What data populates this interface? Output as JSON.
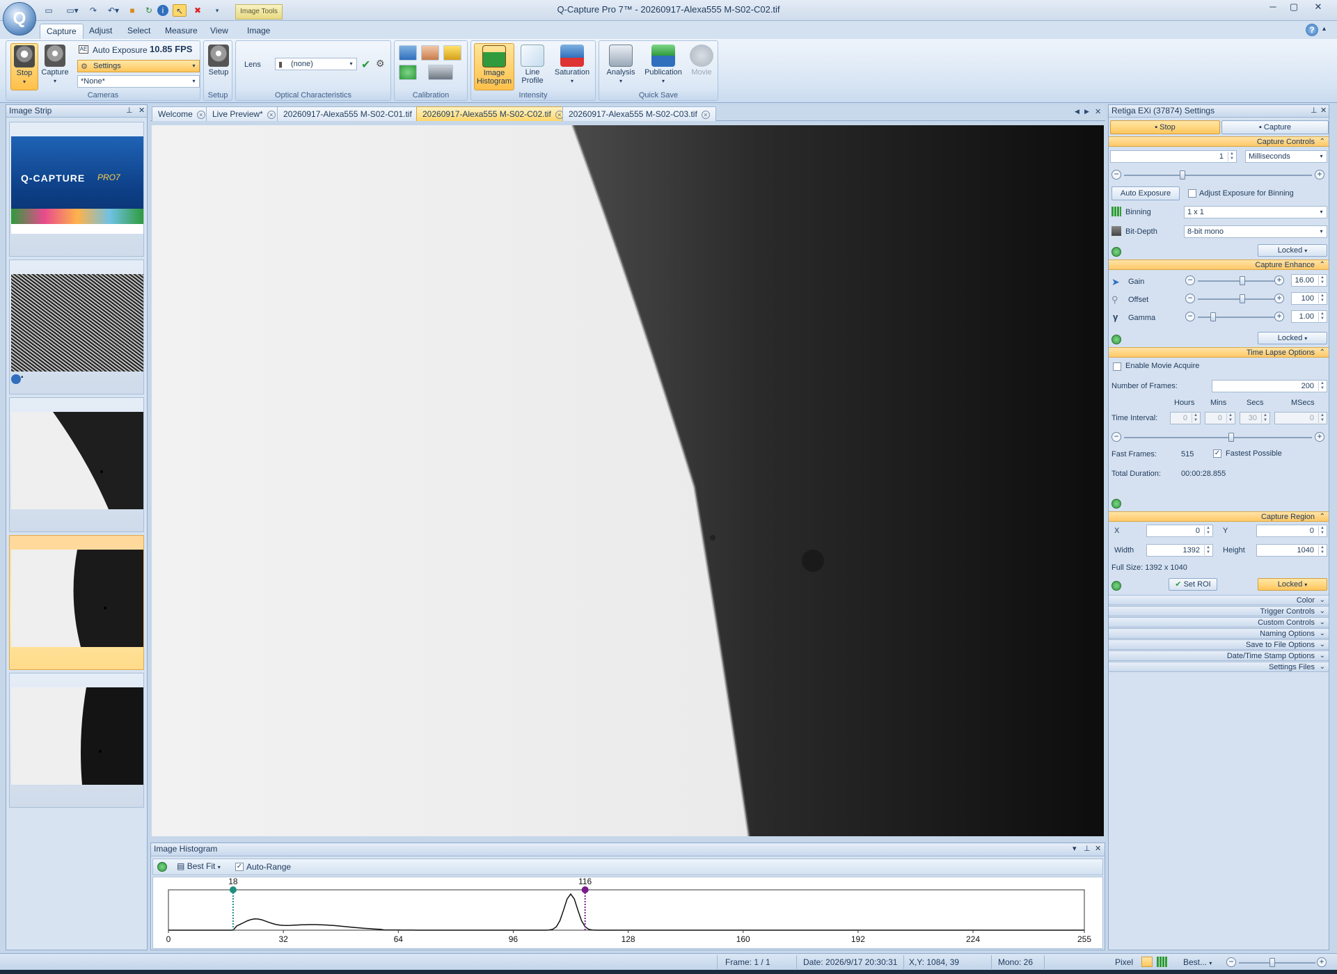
{
  "window": {
    "title": "Q-Capture Pro 7™ - 20260917-Alexa555 M-S02-C02.tif",
    "context_tab": "Image Tools",
    "orb_letter": "Q"
  },
  "ribbon_tabs": [
    "Capture",
    "Adjust",
    "Select",
    "Measure",
    "View",
    "Image"
  ],
  "ribbon": {
    "cameras": {
      "stop": "Stop",
      "capture": "Capture",
      "auto_exposure": "Auto Exposure",
      "fps": "10.85 FPS",
      "settings": "Settings",
      "preset": "*None*",
      "label": "Cameras"
    },
    "setup": {
      "button": "Setup",
      "label": "Setup"
    },
    "optical": {
      "lens_label": "Lens",
      "lens_value": "(none)",
      "label": "Optical Characteristics"
    },
    "calibration": {
      "label": "Calibration"
    },
    "intensity": {
      "image_histogram": "Image Histogram",
      "line_profile": "Line Profile",
      "saturation": "Saturation",
      "label": "Intensity"
    },
    "quick_save": {
      "analysis": "Analysis",
      "publication": "Publication",
      "movie": "Movie",
      "label": "Quick Save"
    }
  },
  "image_strip": {
    "title": "Image Strip"
  },
  "doc_tabs": [
    "Welcome",
    "Live Preview*",
    "20260917-Alexa555 M-S02-C01.tif",
    "20260917-Alexa555 M-S02-C02.tif",
    "20260917-Alexa555 M-S02-C03.tif"
  ],
  "splash": {
    "brand": "Q-CAPTURE",
    "pro": "PRO7"
  },
  "histogram": {
    "title": "Image Histogram",
    "fit": "Best Fit",
    "auto_range": "Auto-Range",
    "min_marker": "18",
    "max_marker": "116",
    "ticks": [
      "0",
      "32",
      "64",
      "96",
      "128",
      "160",
      "192",
      "224",
      "255"
    ]
  },
  "settings": {
    "title": "Retiga EXi (37874) Settings",
    "stop": "Stop",
    "capture": "Capture",
    "capture_controls": {
      "header": "Capture Controls",
      "exposure_value": "1",
      "exposure_unit": "Milliseconds",
      "auto_exposure": "Auto Exposure",
      "adjust_binning": "Adjust Exposure for Binning",
      "binning_label": "Binning",
      "binning_value": "1 x 1",
      "bitdepth_label": "Bit-Depth",
      "bitdepth_value": "8-bit mono",
      "locked": "Locked"
    },
    "capture_enhance": {
      "header": "Capture Enhance",
      "gain_label": "Gain",
      "gain_value": "16.00",
      "offset_label": "Offset",
      "offset_value": "100",
      "gamma_label": "Gamma",
      "gamma_value": "1.00",
      "locked": "Locked"
    },
    "time_lapse": {
      "header": "Time Lapse Options",
      "enable_movie": "Enable Movie Acquire",
      "frames_label": "Number of Frames:",
      "frames_value": "200",
      "hours": "Hours",
      "mins": "Mins",
      "secs": "Secs",
      "msecs": "MSecs",
      "interval_label": "Time Interval:",
      "hours_value": "0",
      "mins_value": "0",
      "secs_value": "30",
      "msecs_value": "0",
      "fast_frames_label": "Fast Frames:",
      "fast_frames_value": "515",
      "fastest_possible": "Fastest Possible",
      "total_duration_label": "Total Duration:",
      "total_duration_value": "00:00:28.855"
    },
    "capture_region": {
      "header": "Capture Region",
      "x_label": "X",
      "x_value": "0",
      "y_label": "Y",
      "y_value": "0",
      "width_label": "Width",
      "width_value": "1392",
      "height_label": "Height",
      "height_value": "1040",
      "full_size": "Full Size: 1392 x 1040",
      "set_roi": "Set ROI",
      "locked": "Locked"
    },
    "collapsed_sections": [
      "Color",
      "Trigger Controls",
      "Custom Controls",
      "Naming Options",
      "Save to File Options",
      "Date/Time Stamp Options",
      "Settings Files"
    ]
  },
  "status": {
    "frame": "Frame: 1 / 1",
    "date": "Date: 2026/9/17 20:30:31",
    "xy": "X,Y: 1084,   39",
    "mono": "Mono:   26",
    "pixel": "Pixel",
    "zoom": "Best..."
  },
  "colors": {
    "accent_orange": "#ffc65c",
    "ribbon_blue": "#d8e5f4",
    "histogram_min": "#1f8f7f",
    "histogram_max": "#7a1a8c"
  }
}
